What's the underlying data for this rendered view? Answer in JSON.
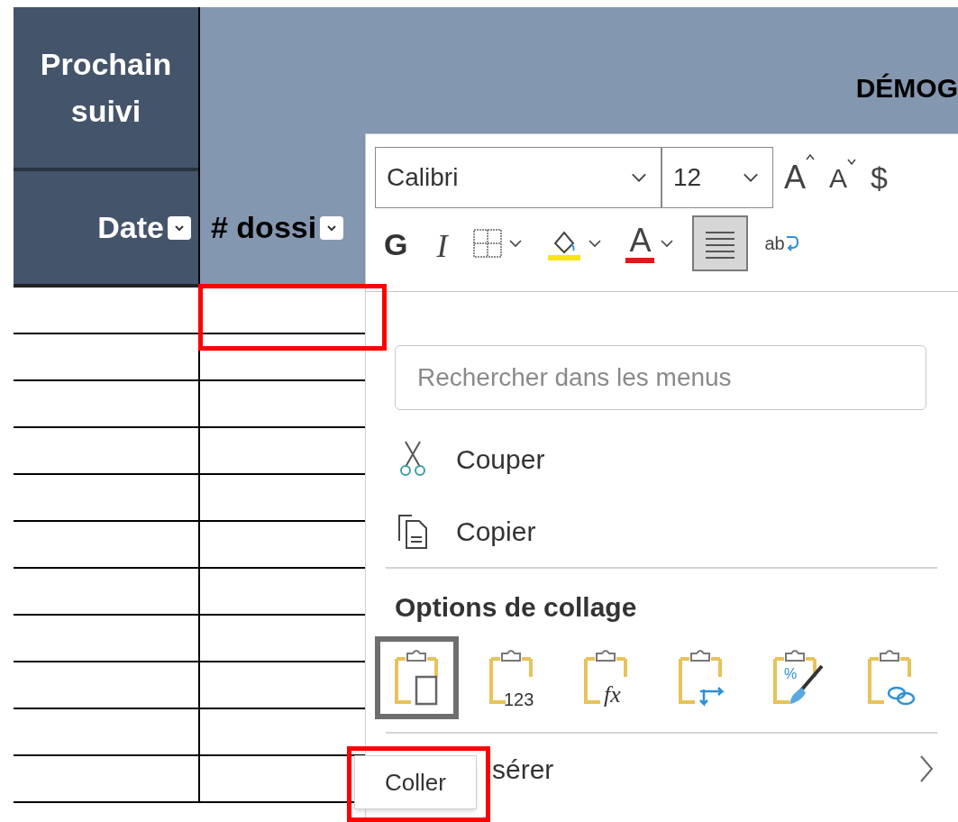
{
  "sheet": {
    "group_title": "Prochain suivi",
    "section_title": "DÉMOG",
    "columns": [
      {
        "label": "Date",
        "filter": true
      },
      {
        "label": "# dossi",
        "filter": true
      }
    ]
  },
  "mini_toolbar": {
    "font": "Calibri",
    "size": "12",
    "row1": [
      {
        "kind": "grow",
        "glyph": "A"
      },
      {
        "kind": "shrink",
        "glyph": "A"
      },
      {
        "kind": "currency",
        "glyph": "$"
      }
    ],
    "row2": [
      {
        "kind": "bold",
        "glyph": "G",
        "selected": false
      },
      {
        "kind": "italic",
        "glyph": "I",
        "selected": false
      },
      {
        "kind": "borders",
        "selected": false
      },
      {
        "kind": "fill",
        "selected": false
      },
      {
        "kind": "fontcolor",
        "glyph": "A",
        "selected": false
      },
      {
        "kind": "align",
        "selected": true
      },
      {
        "kind": "wrap",
        "glyph": "ab",
        "selected": false
      }
    ]
  },
  "context_menu": {
    "search": {
      "placeholder": "Rechercher dans les menus"
    },
    "items": [
      {
        "kind": "cut",
        "label": "Couper"
      },
      {
        "kind": "copy",
        "label": "Copier"
      }
    ],
    "paste_header": "Options de collage",
    "paste_options": [
      {
        "kind": "paste",
        "selected": true
      },
      {
        "kind": "values",
        "glyph": "123",
        "selected": false
      },
      {
        "kind": "formulas",
        "glyph": "fx",
        "selected": false
      },
      {
        "kind": "transpose",
        "selected": false
      },
      {
        "kind": "formatting",
        "glyph": "%",
        "selected": false
      },
      {
        "kind": "link",
        "selected": false
      }
    ],
    "submenu": {
      "label": "sérer",
      "has_submenu": true
    }
  },
  "tooltip": "Coller"
}
